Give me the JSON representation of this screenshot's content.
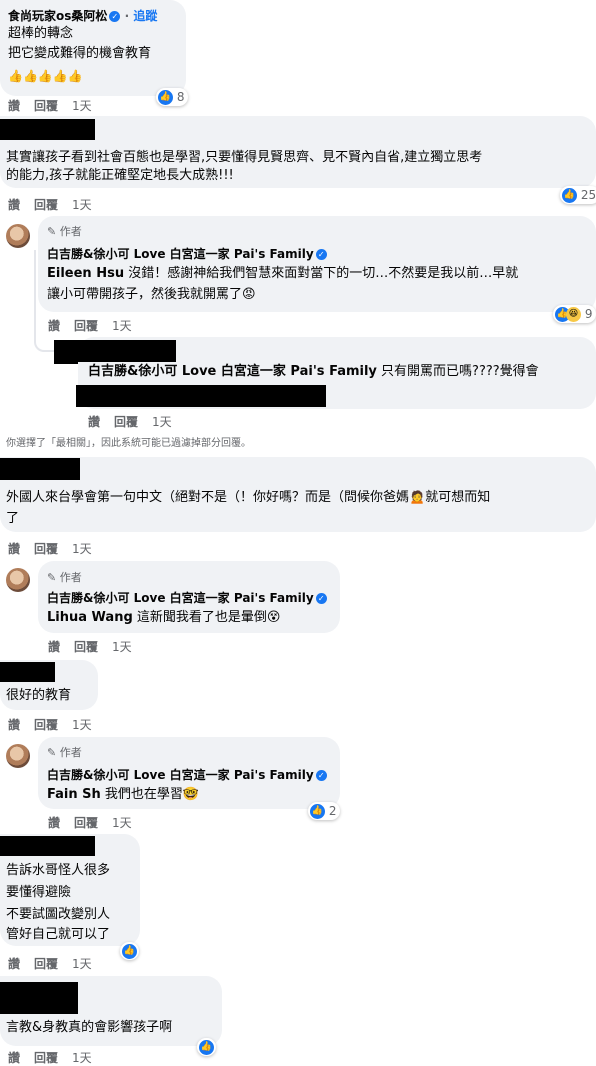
{
  "comment1": {
    "name": "食尚玩家os桑阿松",
    "follow": "追蹤",
    "lines": [
      "超棒的轉念",
      "把它變成難得的機會教育",
      "👍👍👍👍👍"
    ],
    "reactions": "8",
    "actions": {
      "like": "讚",
      "reply": "回覆",
      "time": "1天"
    }
  },
  "comment2": {
    "lines": [
      "其實讓孩子看到社會百態也是學習,只要懂得見賢思齊、見不賢內自省,建立獨立思考",
      "的能力,孩子就能正確堅定地長大成熟!!!"
    ],
    "reactions": "25",
    "actions": {
      "like": "讚",
      "reply": "回覆",
      "time": "1天"
    }
  },
  "reply1": {
    "author": "作者",
    "name": "白吉勝&徐小可 Love 白宮這一家 Pai's Family",
    "tag": "Eileen Hsu",
    "line1": " 沒錯！感謝神給我們智慧來面對當下的一切…不然要是我以前…早就",
    "line2": "讓小可帶開孩子，然後我就開罵了",
    "reactions": "9",
    "actions": {
      "like": "讚",
      "reply": "回覆",
      "time": "1天"
    }
  },
  "reply2": {
    "tag": "白吉勝&徐小可 Love 白宮這一家 Pai's Family",
    "text": " 只有開罵而已嗎????覺得會",
    "actions": {
      "like": "讚",
      "reply": "回覆",
      "time": "1天"
    }
  },
  "filter_note": "你選擇了「最相關」，因此系統可能已過濾掉部分回覆。",
  "comment3": {
    "line1": "外國人來台學會第一句中文（絕對不是（！你好嗎？而是（問候你爸媽",
    "line1_end": "就可想而知",
    "line2": "了",
    "actions": {
      "like": "讚",
      "reply": "回覆",
      "time": "1天"
    }
  },
  "reply3": {
    "author": "作者",
    "name": "白吉勝&徐小可 Love 白宮這一家 Pai's Family",
    "tag": "Lihua Wang",
    "text": " 這新聞我看了也是暈倒",
    "actions": {
      "like": "讚",
      "reply": "回覆",
      "time": "1天"
    }
  },
  "comment4": {
    "text": "很好的教育",
    "actions": {
      "like": "讚",
      "reply": "回覆",
      "time": "1天"
    }
  },
  "reply4": {
    "author": "作者",
    "name": "白吉勝&徐小可 Love 白宮這一家 Pai's Family",
    "tag": "Fain Sh",
    "text": " 我們也在學習",
    "reactions": "2",
    "actions": {
      "like": "讚",
      "reply": "回覆",
      "time": "1天"
    }
  },
  "comment5": {
    "lines": [
      "告訴水哥怪人很多",
      "要懂得避險",
      "不要試圖改變別人",
      "管好自己就可以了"
    ],
    "actions": {
      "like": "讚",
      "reply": "回覆",
      "time": "1天"
    }
  },
  "comment6": {
    "text": "言教&身教真的會影響孩子啊",
    "actions": {
      "like": "讚",
      "reply": "回覆",
      "time": "1天"
    }
  },
  "colors": {
    "accent": "#1877f2",
    "bubble": "#f0f2f5",
    "muted": "#65676b"
  },
  "icons": [
    "verified-icon",
    "like-icon",
    "haha-icon",
    "pencil-icon",
    "avatar"
  ]
}
